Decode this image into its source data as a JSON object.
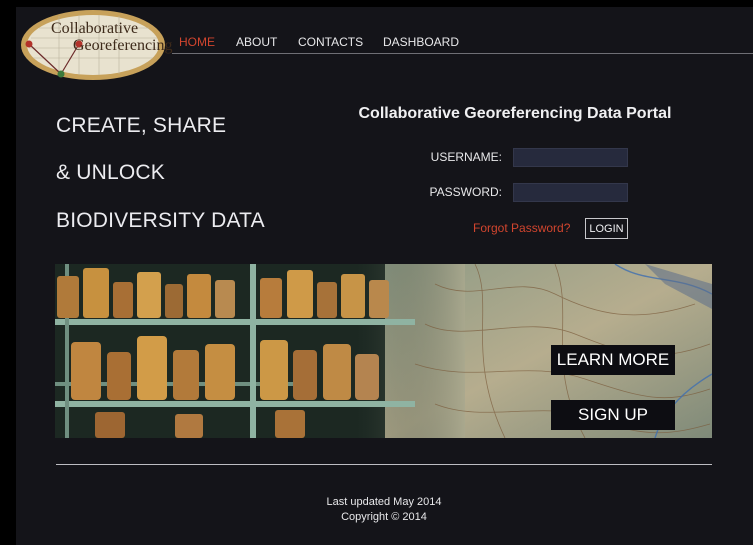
{
  "logo": {
    "line1": "Collaborative",
    "line2": "Georeferencing",
    "icon": "map-logo-icon"
  },
  "nav": {
    "items": [
      {
        "label": "HOME",
        "active": true
      },
      {
        "label": "ABOUT",
        "active": false
      },
      {
        "label": "CONTACTS",
        "active": false
      },
      {
        "label": "DASHBOARD",
        "active": false
      }
    ]
  },
  "hero": {
    "line1": "CREATE, SHARE",
    "line2": "& UNLOCK",
    "line3": "BIODIVERSITY DATA"
  },
  "login": {
    "title": "Collaborative Georeferencing Data Portal",
    "username_label": "USERNAME:",
    "username_value": "",
    "password_label": "PASSWORD:",
    "password_value": "",
    "forgot_label": "Forgot Password?",
    "login_label": "LOGIN"
  },
  "banner": {
    "learn_more_label": "LEARN MORE",
    "sign_up_label": "SIGN UP"
  },
  "footer": {
    "updated": "Last updated May 2014",
    "copyright": "Copyright © 2014"
  },
  "colors": {
    "background": "#141419",
    "accent": "#d1452e",
    "field": "#262a3d"
  }
}
